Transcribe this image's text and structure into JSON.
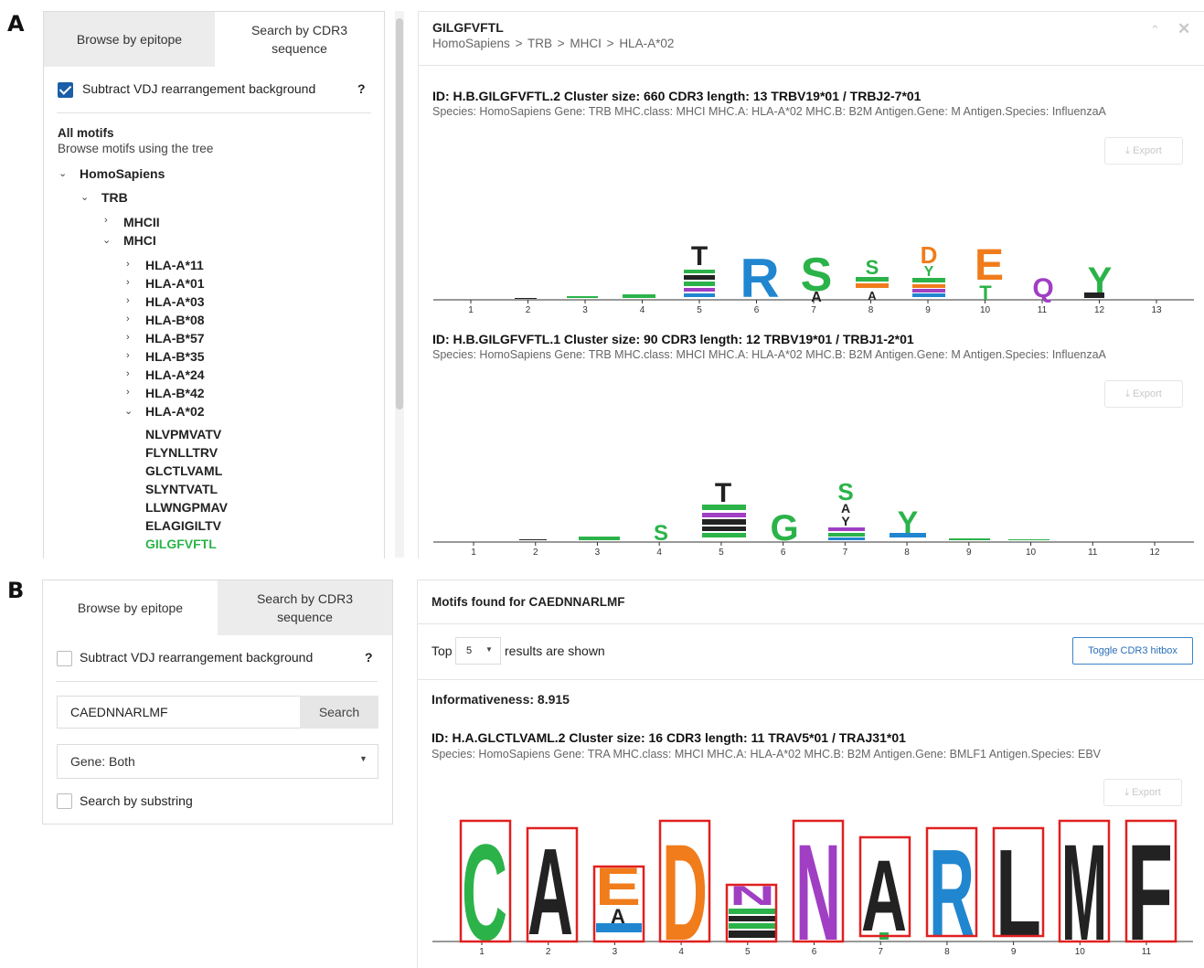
{
  "panel_a": {
    "label": "A",
    "tabs": [
      "Browse by epitope",
      "Search by CDR3 sequence"
    ],
    "subtract_label": "Subtract VDJ rearrangement background",
    "help": "?",
    "all_motifs_title": "All motifs",
    "all_motifs_sub": "Browse motifs using the tree",
    "tree": {
      "species": "HomoSapiens",
      "gene": "TRB",
      "mhcii": "MHCII",
      "mhci": "MHCI",
      "alleles": [
        "HLA-A*11",
        "HLA-A*01",
        "HLA-A*03",
        "HLA-B*08",
        "HLA-B*57",
        "HLA-B*35",
        "HLA-A*24",
        "HLA-B*42",
        "HLA-A*02"
      ],
      "epitopes": [
        "NLVPMVATV",
        "FLYNLLTRV",
        "GLCTLVAML",
        "SLYNTVATL",
        "LLWNGPMAV",
        "ELAGIGILTV",
        "GILGFVFTL"
      ]
    },
    "header_title": "GILGFVFTL",
    "breadcrumb": [
      "HomoSapiens",
      ">",
      "TRB",
      ">",
      "MHCI",
      ">",
      "HLA-A*02"
    ],
    "header_icons": [
      "chevron-up-icon",
      "close-icon"
    ],
    "export_label": "Export",
    "motifs": [
      {
        "id_line": "ID: H.B.GILGFVFTL.2   Cluster size: 660   CDR3 length: 13   TRBV19*01 / TRBJ2-7*01",
        "species_line": "Species: HomoSapiens   Gene: TRB   MHC.class: MHCI   MHC.A: HLA-A*02   MHC.B: B2M   Antigen.Gene: M   Antigen.Species: InfluenzaA",
        "positions": [
          "1",
          "2",
          "3",
          "4",
          "5",
          "6",
          "7",
          "8",
          "9",
          "10",
          "11",
          "12",
          "13"
        ]
      },
      {
        "id_line": "ID: H.B.GILGFVFTL.1   Cluster size: 90   CDR3 length: 12   TRBV19*01 / TRBJ1-2*01",
        "species_line": "Species: HomoSapiens   Gene: TRB   MHC.class: MHCI   MHC.A: HLA-A*02   MHC.B: B2M   Antigen.Gene: M   Antigen.Species: InfluenzaA",
        "positions": [
          "1",
          "2",
          "3",
          "4",
          "5",
          "6",
          "7",
          "8",
          "9",
          "10",
          "11",
          "12"
        ]
      }
    ]
  },
  "panel_b": {
    "label": "B",
    "tabs": [
      "Browse by epitope",
      "Search by CDR3 sequence"
    ],
    "subtract_label": "Subtract VDJ rearrangement background",
    "help": "?",
    "search_value": "CAEDNNARLMF",
    "search_button": "Search",
    "gene_select": "Gene: Both",
    "substring_label": "Search by substring",
    "header_title": "Motifs found for CAEDNNARLMF",
    "top_label": "Top",
    "top_value": "5",
    "results_label": "results are shown",
    "toggle_label": "Toggle CDR3 hitbox",
    "informativeness": "Informativeness: 8.915",
    "id_line": "ID: H.A.GLCTLVAML.2   Cluster size: 16   CDR3 length: 11   TRAV5*01 / TRAJ31*01",
    "species_line": "Species: HomoSapiens   Gene: TRA   MHC.class: MHCI   MHC.A: HLA-A*02   MHC.B: B2M   Antigen.Gene: BMLF1   Antigen.Species: EBV",
    "export_label": "Export",
    "positions": [
      "1",
      "2",
      "3",
      "4",
      "5",
      "6",
      "7",
      "8",
      "9",
      "10",
      "11"
    ]
  },
  "colors": {
    "green": "#2bb34a",
    "blue": "#2186d0",
    "orange": "#f07c1c",
    "purple": "#a03fc3",
    "black": "#222222",
    "red_box": "#e02020",
    "selected_epitope": "#2bb34a"
  }
}
